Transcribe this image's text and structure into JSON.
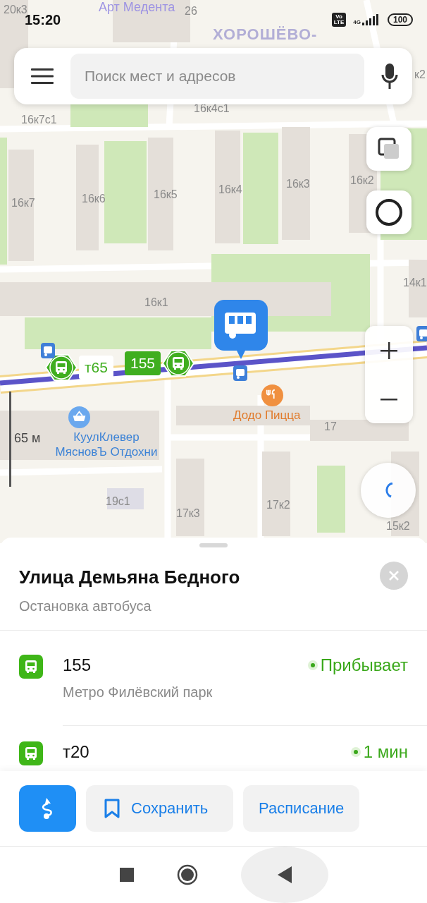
{
  "status_bar": {
    "time": "15:20",
    "volte_top": "Vo",
    "volte_bottom": "LTE",
    "network": "4G",
    "battery": "100"
  },
  "search": {
    "placeholder": "Поиск мест и адресов"
  },
  "map": {
    "labels": [
      {
        "text": "20к3",
        "kind": "building"
      },
      {
        "text": "Арт Медента",
        "kind": "place"
      },
      {
        "text": "26",
        "kind": "building"
      },
      {
        "text": "ХОРОШЁВО-",
        "kind": "district"
      },
      {
        "text": "к2",
        "kind": "building"
      },
      {
        "text": "16к4с1",
        "kind": "building"
      },
      {
        "text": "16к7с1",
        "kind": "building"
      },
      {
        "text": "16к7",
        "kind": "building"
      },
      {
        "text": "16к6",
        "kind": "building"
      },
      {
        "text": "16к5",
        "kind": "building"
      },
      {
        "text": "16к4",
        "kind": "building"
      },
      {
        "text": "16к3",
        "kind": "building"
      },
      {
        "text": "16к2",
        "kind": "building"
      },
      {
        "text": "14к1",
        "kind": "building"
      },
      {
        "text": "16к1",
        "kind": "building"
      },
      {
        "text": "17",
        "kind": "building"
      },
      {
        "text": "19с1",
        "kind": "building"
      },
      {
        "text": "17к3",
        "kind": "building"
      },
      {
        "text": "17к2",
        "kind": "building"
      },
      {
        "text": "15к2",
        "kind": "building"
      }
    ],
    "pois": [
      {
        "name": "Додо Пицца",
        "kind": "restaurant"
      },
      {
        "name": "КуулКлевер МясновЪ Отдохни",
        "kind": "shop"
      }
    ],
    "route_tags": [
      {
        "route": "т65",
        "highlighted": false
      },
      {
        "route": "155",
        "highlighted": true
      }
    ],
    "scale": "65 м"
  },
  "place": {
    "title": "Улица Демьяна Бедного",
    "subtitle": "Остановка автобуса"
  },
  "arrivals": [
    {
      "route": "155",
      "destination": "Метро Филёвский парк",
      "status": "Прибывает"
    },
    {
      "route": "т20",
      "status": "1 мин"
    }
  ],
  "actions": [
    {
      "kind": "route"
    },
    {
      "kind": "bookmark",
      "label": "Сохранить"
    },
    {
      "kind": "plain",
      "label": "Расписание"
    }
  ]
}
